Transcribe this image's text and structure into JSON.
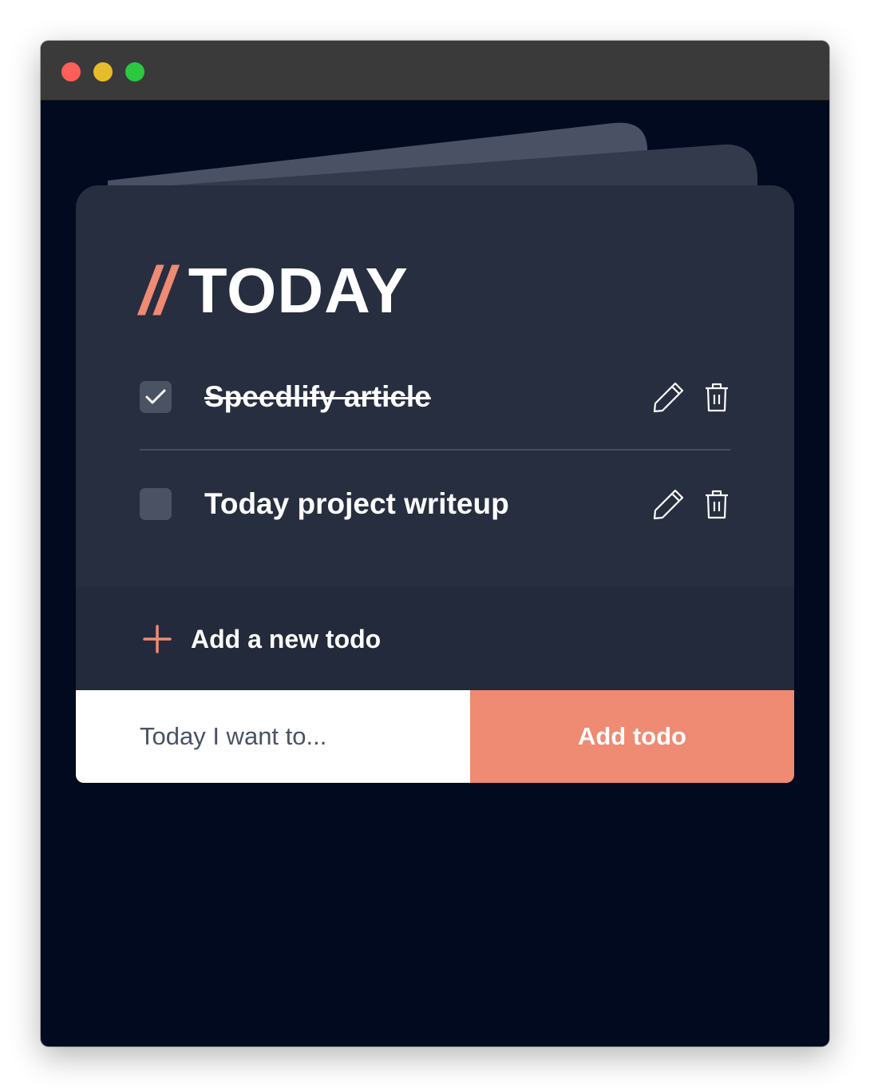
{
  "colors": {
    "accent": "#ef8a73",
    "window_bg": "#020a1f",
    "card_bg": "#272e40",
    "checkbox_bg": "#4b5264",
    "traffic_red": "#fe5f57",
    "traffic_yellow": "#e7bc2a",
    "traffic_green": "#2bc840"
  },
  "header": {
    "slashes": "//",
    "title": "TODAY"
  },
  "todos": [
    {
      "text": "Speedlify article",
      "done": true
    },
    {
      "text": "Today project writeup",
      "done": false
    }
  ],
  "icons": {
    "checkbox_checked": "check-icon",
    "edit": "pencil-icon",
    "delete": "trash-icon",
    "add": "plus-icon"
  },
  "add_section": {
    "label": "Add a new todo"
  },
  "form": {
    "input_placeholder": "Today I want to...",
    "input_value": "",
    "button_label": "Add todo"
  }
}
